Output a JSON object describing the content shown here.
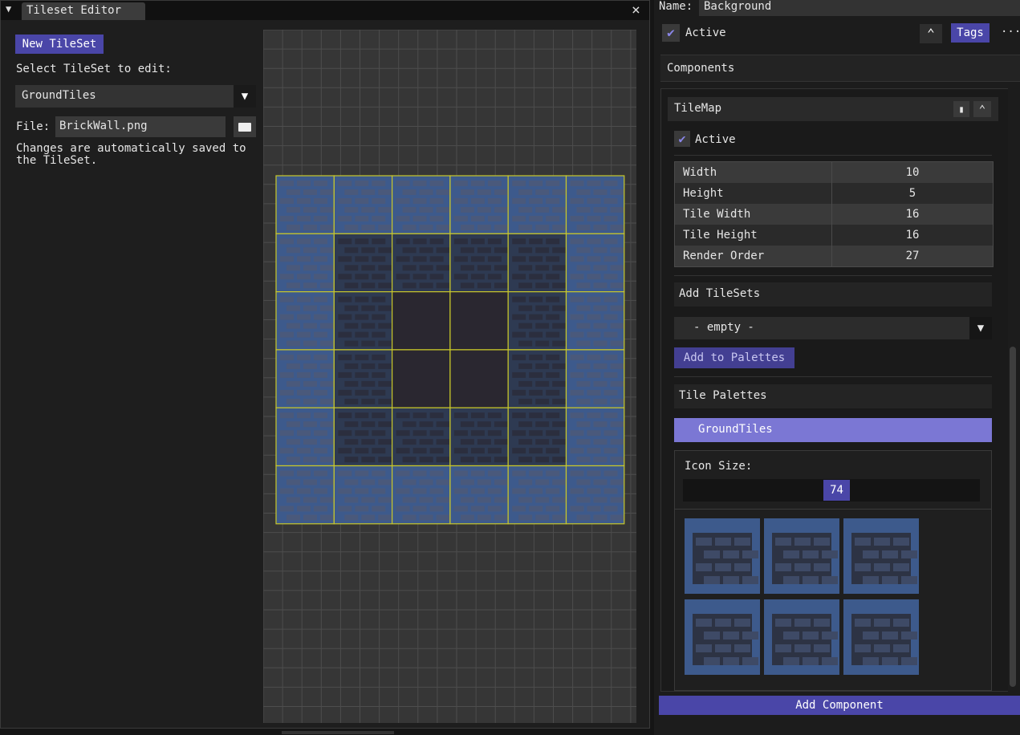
{
  "editor": {
    "title": "Tileset Editor",
    "new_tileset_label": "New TileSet",
    "select_label": "Select TileSet to edit:",
    "selected_tileset": "GroundTiles",
    "file_label": "File:",
    "file_value": "BrickWall.png",
    "autosave_note_1": "Changes are automatically saved to",
    "autosave_note_2": "the TileSet."
  },
  "inspector": {
    "name_label": "Name:",
    "name_value": "Background",
    "active_label": "Active",
    "tags_label": "Tags",
    "more_label": "···",
    "components_label": "Components",
    "tilemap": {
      "title": "TileMap",
      "active_label": "Active",
      "properties": [
        {
          "key": "Width",
          "value": "10"
        },
        {
          "key": "Height",
          "value": "5"
        },
        {
          "key": "Tile Width",
          "value": "16"
        },
        {
          "key": "Tile Height",
          "value": "16"
        },
        {
          "key": "Render Order",
          "value": "27"
        }
      ],
      "add_tilesets_label": "Add TileSets",
      "tileset_dropdown": "- empty -",
      "add_to_palettes_label": "Add to Palettes",
      "tile_palettes_label": "Tile Palettes",
      "palette_selected": "GroundTiles",
      "icon_size_label": "Icon Size:",
      "icon_size_value": 74
    },
    "add_component_label": "Add Component"
  },
  "colors": {
    "accent": "#4a46a8",
    "palette_highlight": "#7b77d4",
    "grid_highlight": "#c9c82a",
    "tile_blue": "#3d5a8c"
  }
}
